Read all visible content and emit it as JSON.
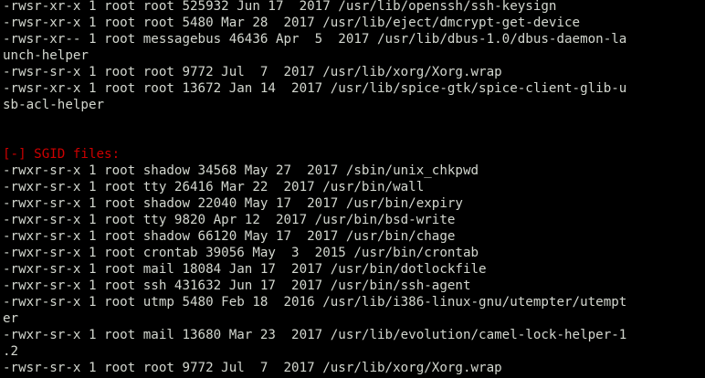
{
  "colors": {
    "background": "#000000",
    "text": "#d3d7cf",
    "section_header": "#cc0000"
  },
  "lines": [
    "-rwsr-xr-x 1 root root 525932 Jun 17  2017 /usr/lib/openssh/ssh-keysign",
    "-rwsr-xr-x 1 root root 5480 Mar 28  2017 /usr/lib/eject/dmcrypt-get-device",
    "-rwsr-xr-- 1 root messagebus 46436 Apr  5  2017 /usr/lib/dbus-1.0/dbus-daemon-la",
    "unch-helper",
    "-rwsr-sr-x 1 root root 9772 Jul  7  2017 /usr/lib/xorg/Xorg.wrap",
    "-rwsr-xr-x 1 root root 13672 Jan 14  2017 /usr/lib/spice-gtk/spice-client-glib-u",
    "sb-acl-helper",
    "",
    "",
    "[-] SGID files:",
    "-rwxr-sr-x 1 root shadow 34568 May 27  2017 /sbin/unix_chkpwd",
    "-rwxr-sr-x 1 root tty 26416 Mar 22  2017 /usr/bin/wall",
    "-rwxr-sr-x 1 root shadow 22040 May 17  2017 /usr/bin/expiry",
    "-rwxr-sr-x 1 root tty 9820 Apr 12  2017 /usr/bin/bsd-write",
    "-rwxr-sr-x 1 root shadow 66120 May 17  2017 /usr/bin/chage",
    "-rwxr-sr-x 1 root crontab 39056 May  3  2015 /usr/bin/crontab",
    "-rwxr-sr-x 1 root mail 18084 Jan 17  2017 /usr/bin/dotlockfile",
    "-rwxr-sr-x 1 root ssh 431632 Jun 17  2017 /usr/bin/ssh-agent",
    "-rwxr-sr-x 1 root utmp 5480 Feb 18  2016 /usr/lib/i386-linux-gnu/utempter/utempt",
    "er",
    "-rwxr-sr-x 1 root mail 13680 Mar 23  2017 /usr/lib/evolution/camel-lock-helper-1",
    ".2",
    "-rwsr-sr-x 1 root root 9772 Jul  7  2017 /usr/lib/xorg/Xorg.wrap"
  ]
}
